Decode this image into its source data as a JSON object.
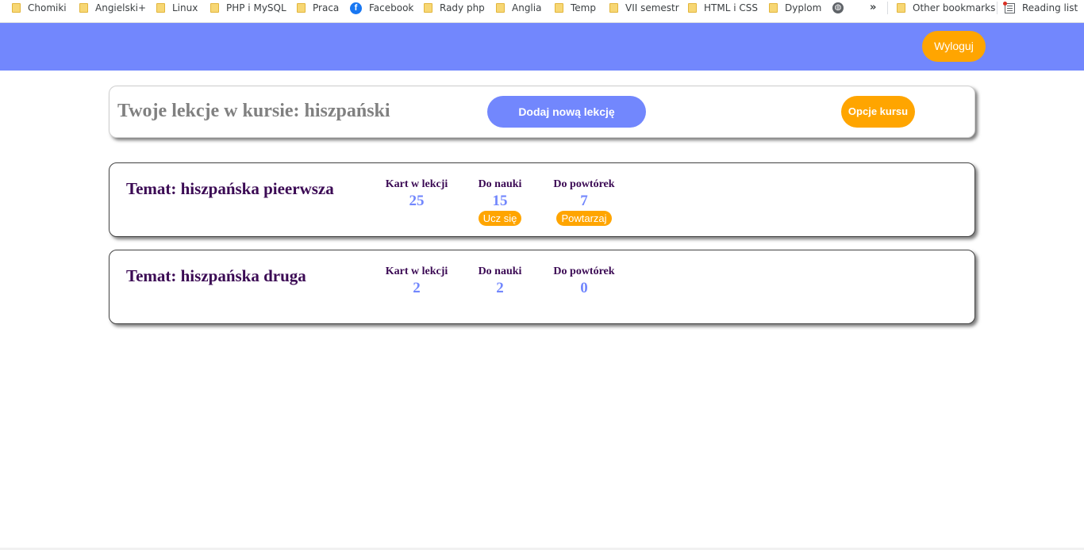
{
  "bookmarks": {
    "items": [
      {
        "label": "Chomiki",
        "icon": "folder-icon"
      },
      {
        "label": "Angielski+",
        "icon": "folder-icon"
      },
      {
        "label": "Linux",
        "icon": "folder-icon"
      },
      {
        "label": "PHP i MySQL",
        "icon": "folder-icon"
      },
      {
        "label": "Praca",
        "icon": "folder-icon"
      },
      {
        "label": "Facebook",
        "icon": "facebook-icon"
      },
      {
        "label": "Rady php",
        "icon": "folder-icon"
      },
      {
        "label": "Anglia",
        "icon": "folder-icon"
      },
      {
        "label": "Temp",
        "icon": "folder-icon"
      },
      {
        "label": "VII semestr",
        "icon": "folder-icon"
      },
      {
        "label": "HTML i CSS",
        "icon": "folder-icon"
      },
      {
        "label": "Dyplom",
        "icon": "folder-icon"
      }
    ],
    "overflow": "»",
    "other_bookmarks": "Other bookmarks",
    "reading_list": "Reading list"
  },
  "header": {
    "logout_label": "Wyloguj"
  },
  "course": {
    "title": "Twoje lekcje w kursie: hiszpański",
    "add_lesson_label": "Dodaj nową lekcję",
    "options_label": "Opcje kursu"
  },
  "lessons": [
    {
      "title": "Temat: hiszpańska pieerwsza",
      "stats": [
        {
          "label": "Kart w lekcji",
          "value": "25"
        },
        {
          "label": "Do nauki",
          "value": "15",
          "action": "Ucz się"
        },
        {
          "label": "Do powtórek",
          "value": "7",
          "action": "Powtarzaj"
        }
      ]
    },
    {
      "title": "Temat: hiszpańska druga",
      "stats": [
        {
          "label": "Kart w lekcji",
          "value": "2"
        },
        {
          "label": "Do nauki",
          "value": "2"
        },
        {
          "label": "Do powtórek",
          "value": "0"
        }
      ]
    }
  ],
  "colors": {
    "accent_blue": "#7287fd",
    "accent_orange": "#ffa500",
    "title_purple": "#3b0a54"
  }
}
